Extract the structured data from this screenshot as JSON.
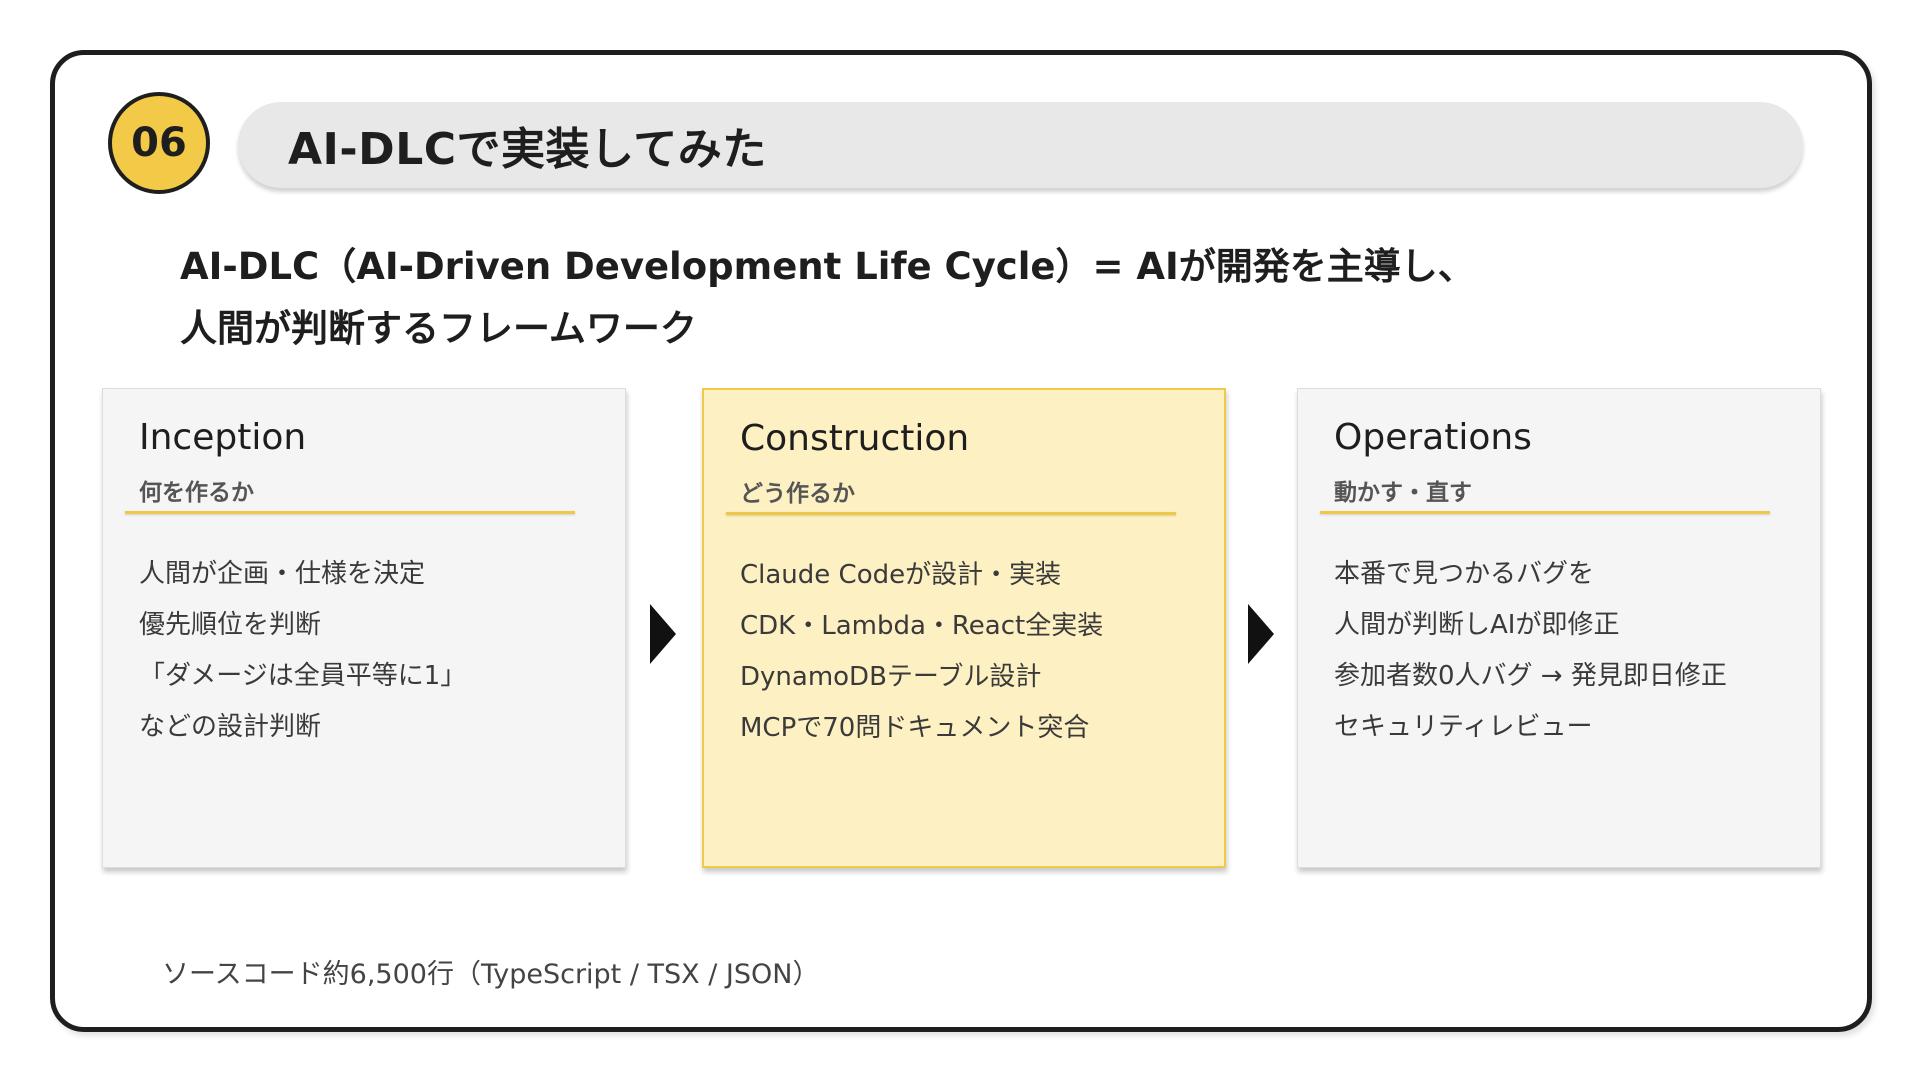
{
  "header": {
    "number": "06",
    "title": "AI-DLCで実装してみた"
  },
  "lead": {
    "line1": "AI-DLC（AI-Driven Development Life Cycle）= AIが開発を主導し、",
    "line2": "人間が判断するフレームワーク"
  },
  "phases": [
    {
      "name": "Inception",
      "subtitle": "何を作るか",
      "items": [
        "人間が企画・仕様を決定",
        "優先順位を判断",
        "「ダメージは全員平等に1」",
        "などの設計判断"
      ]
    },
    {
      "name": "Construction",
      "subtitle": "どう作るか",
      "items": [
        "Claude Codeが設計・実装",
        "CDK・Lambda・React全実装",
        "DynamoDBテーブル設計",
        "MCPで70問ドキュメント突合"
      ]
    },
    {
      "name": "Operations",
      "subtitle": "動かす・直す",
      "items": [
        "本番で見つかるバグを",
        "人間が判断しAIが即修正",
        "参加者数0人バグ → 発見即日修正",
        "セキュリティレビュー"
      ]
    }
  ],
  "footnote": "ソースコード約6,500行（TypeScript / TSX / JSON）",
  "colors": {
    "accent": "#f3c948",
    "highlight_card": "#fdf0c2",
    "card": "#f5f5f5",
    "title_bar": "#e8e8e8"
  }
}
